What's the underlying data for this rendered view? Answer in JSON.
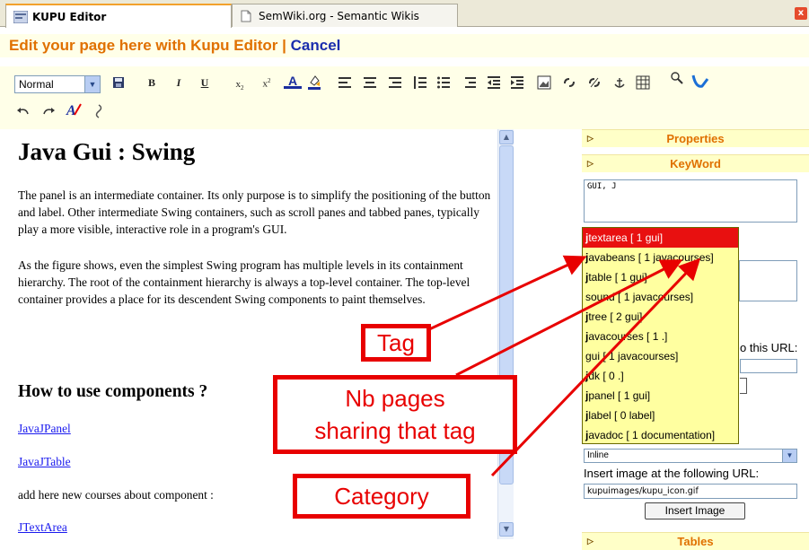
{
  "tabs": [
    {
      "label": "KUPU Editor",
      "active": true
    },
    {
      "label": "SemWiki.org - Semantic Wikis",
      "active": false
    }
  ],
  "header": {
    "title": "Edit your page here with Kupu Editor",
    "separator": "|",
    "cancel": "Cancel"
  },
  "toolbar": {
    "style_select": "Normal",
    "bold": "B",
    "italic": "I",
    "underline": "U",
    "subscript": "x",
    "superscript": "x",
    "text_color": "A"
  },
  "content": {
    "title": "Java Gui : Swing",
    "para1": "The panel is an intermediate container. Its only purpose is to simplify the positioning of the button and label. Other intermediate Swing containers, such as scroll panes and tabbed panes, typically play a more visible, interactive role in a program's GUI.",
    "para2": "As the figure shows, even the simplest Swing program has multiple levels in its containment hierarchy. The root of the containment hierarchy is always a top-level container. The top-level container provides a place for its descendent Swing components to paint themselves.",
    "heading2": "How to use components ?",
    "links": [
      "JavaJPanel",
      "JavaJTable"
    ],
    "add_text": "add here new courses about component :",
    "link3": "JTextArea"
  },
  "sidebar": {
    "properties": "Properties",
    "keyword": "KeyWord",
    "keyword_value": "GUI, J",
    "url_label": "o this URL:",
    "inline_select": "Inline",
    "image_label": "Insert image at the following URL:",
    "image_url": "kupuimages/kupu_icon.gif",
    "insert_button": "Insert Image",
    "tables": "Tables"
  },
  "suggestions": [
    {
      "tag": "j",
      "rest": "textarea [ 1 gui]",
      "selected": true
    },
    {
      "tag": "j",
      "rest": "avabeans [ 1 javacourses]",
      "selected": false
    },
    {
      "tag": "j",
      "rest": "table [ 1 gui]",
      "selected": false
    },
    {
      "tag": "",
      "rest": "sound [ 1 javacourses]",
      "selected": false
    },
    {
      "tag": "j",
      "rest": "tree [ 2 gui]",
      "selected": false
    },
    {
      "tag": "j",
      "rest": "avacourses [ 1 .]",
      "selected": false
    },
    {
      "tag": "",
      "rest": "gui [ 1 javacourses]",
      "selected": false
    },
    {
      "tag": "j",
      "rest": "dk [ 0 .]",
      "selected": false
    },
    {
      "tag": "j",
      "rest": "panel [ 1 gui]",
      "selected": false
    },
    {
      "tag": "j",
      "rest": "label [ 0 label]",
      "selected": false
    },
    {
      "tag": "j",
      "rest": "avadoc [ 1 documentation]",
      "selected": false
    }
  ],
  "callouts": {
    "tag": "Tag",
    "nb_line1": "Nb pages",
    "nb_line2": "sharing that tag",
    "category": "Category"
  },
  "colors": {
    "accent": "#e07000",
    "cancel": "#1a2dad",
    "callout": "#e80000",
    "panel_bg": "#ffffc8",
    "selected": "#e81010"
  }
}
